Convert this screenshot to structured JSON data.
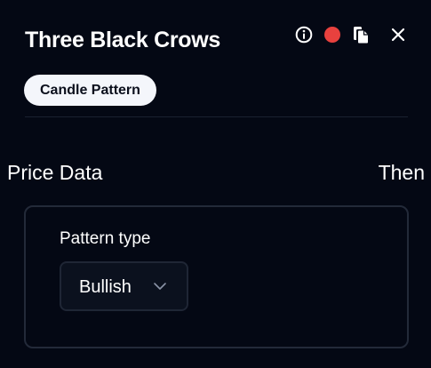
{
  "panel": {
    "title": "Three Black Crows",
    "badge": "Candle Pattern"
  },
  "header": {
    "icons": [
      "info-icon",
      "status-dot-icon",
      "copy-icon",
      "close-icon"
    ],
    "status_color": "#e8413e"
  },
  "sections": {
    "left": "Price Data",
    "right": "Then"
  },
  "pattern": {
    "label": "Pattern type",
    "selected": "Bullish"
  },
  "colors": {
    "background": "#040814",
    "badge_bg": "#f4f6fb",
    "card_border": "#232a39",
    "select_bg": "#0b111e"
  }
}
